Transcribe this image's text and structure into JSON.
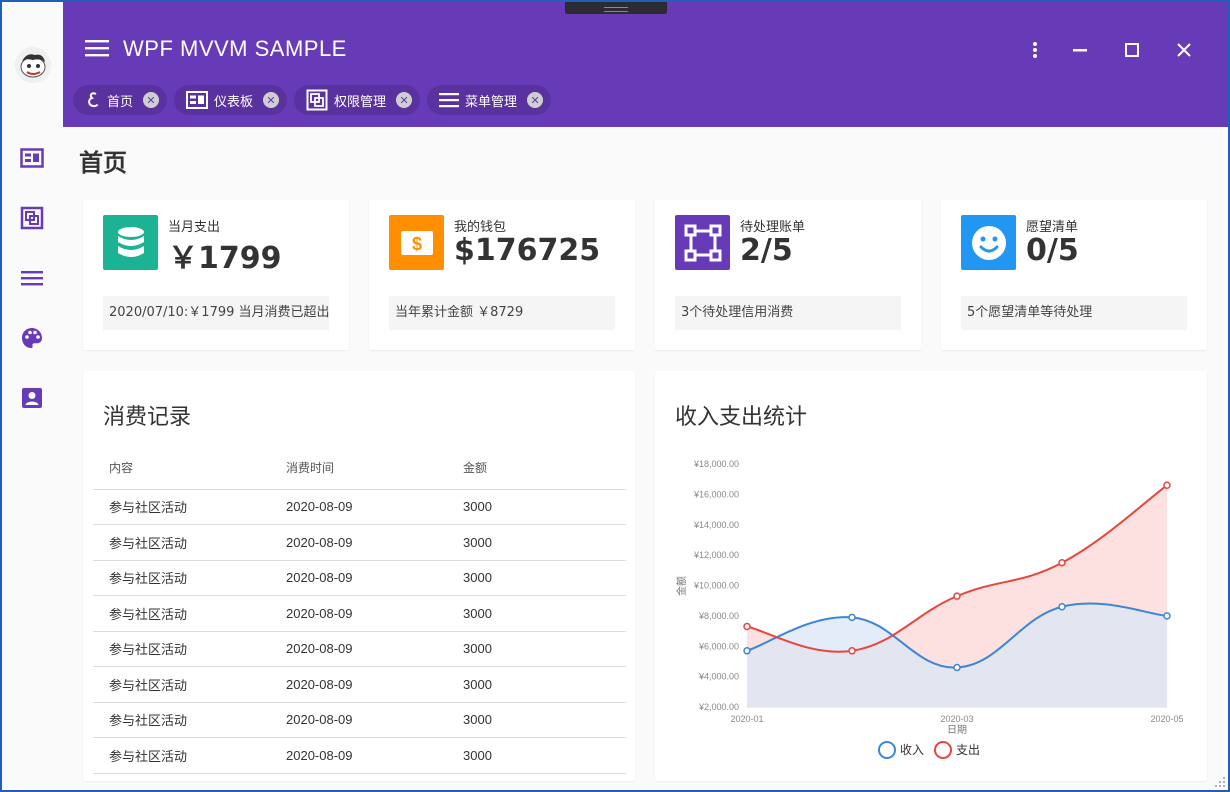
{
  "header": {
    "title": "WPF MVVM SAMPLE",
    "tabs": [
      {
        "label": "首页",
        "icon": "home-script-icon"
      },
      {
        "label": "仪表板",
        "icon": "dashboard-card-icon"
      },
      {
        "label": "权限管理",
        "icon": "permission-squares-icon"
      },
      {
        "label": "菜单管理",
        "icon": "menu-lines-icon"
      }
    ]
  },
  "sidebar": {
    "items": [
      {
        "name": "dashboard",
        "icon": "dashboard-card-icon"
      },
      {
        "name": "permission",
        "icon": "permission-squares-icon"
      },
      {
        "name": "menu",
        "icon": "menu-lines-icon"
      },
      {
        "name": "theme",
        "icon": "palette-icon"
      },
      {
        "name": "account",
        "icon": "account-box-icon"
      }
    ]
  },
  "page": {
    "title": "首页"
  },
  "stats": [
    {
      "label": "当月支出",
      "value": "￥1799",
      "note": "2020/07/10:￥1799  当月消费已超出",
      "color": "#1bb394",
      "icon": "database-icon"
    },
    {
      "label": "我的钱包",
      "value": "$176725",
      "note": "当年累计金额  ￥8729",
      "color": "#ff8f00",
      "icon": "cash-icon"
    },
    {
      "label": "待处理账单",
      "value": "2/5",
      "note": "3个待处理信用消费",
      "color": "#673ab7",
      "icon": "vector-square-icon"
    },
    {
      "label": "愿望清单",
      "value": "0/5",
      "note": "5个愿望清单等待处理",
      "color": "#2196f3",
      "icon": "smile-icon"
    }
  ],
  "records": {
    "title": "消费记录",
    "columns": [
      "内容",
      "消费时间",
      "金额"
    ],
    "rows": [
      [
        "参与社区活动",
        "2020-08-09",
        "3000"
      ],
      [
        "参与社区活动",
        "2020-08-09",
        "3000"
      ],
      [
        "参与社区活动",
        "2020-08-09",
        "3000"
      ],
      [
        "参与社区活动",
        "2020-08-09",
        "3000"
      ],
      [
        "参与社区活动",
        "2020-08-09",
        "3000"
      ],
      [
        "参与社区活动",
        "2020-08-09",
        "3000"
      ],
      [
        "参与社区活动",
        "2020-08-09",
        "3000"
      ],
      [
        "参与社区活动",
        "2020-08-09",
        "3000"
      ]
    ]
  },
  "chart_data": {
    "type": "area",
    "title": "收入支出统计",
    "xlabel": "日期",
    "ylabel": "金额",
    "x": [
      "2020-01",
      "2020-02",
      "2020-03",
      "2020-04",
      "2020-05"
    ],
    "x_tick_labels": [
      "2020-01",
      "2020-03",
      "2020-05"
    ],
    "ylim": [
      2000,
      18000
    ],
    "y_tick_labels": [
      "¥2,000.00",
      "¥4,000.00",
      "¥6,000.00",
      "¥8,000.00",
      "¥10,000.00",
      "¥12,000.00",
      "¥14,000.00",
      "¥16,000.00",
      "¥18,000.00"
    ],
    "series": [
      {
        "name": "收入",
        "values": [
          5700,
          7900,
          4600,
          8600,
          8000
        ],
        "color": "#3b86d6",
        "fill": "#d9e6f5"
      },
      {
        "name": "支出",
        "values": [
          7300,
          5700,
          9300,
          11500,
          16600
        ],
        "color": "#e8453c",
        "fill": "#fde1e1"
      }
    ],
    "grid": false,
    "legend": "bottom"
  }
}
